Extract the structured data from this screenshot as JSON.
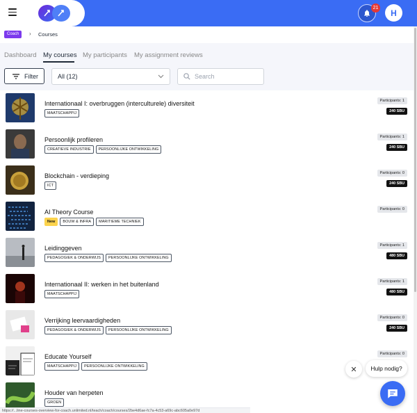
{
  "header": {
    "notification_count": "21",
    "user_initial": "H"
  },
  "breadcrumb": {
    "role": "Coach",
    "current": "Courses"
  },
  "tabs": [
    {
      "label": "Dashboard",
      "active": false
    },
    {
      "label": "My courses",
      "active": true
    },
    {
      "label": "My participants",
      "active": false
    },
    {
      "label": "My assignment reviews",
      "active": false
    }
  ],
  "filters": {
    "filter_label": "Filter",
    "select_value": "All (12)",
    "search_placeholder": "Search"
  },
  "courses": [
    {
      "title": "Internationaal I: overbruggen (interculturele) diversiteit",
      "tags": [
        "MAATSCHAPPIJ"
      ],
      "new": false,
      "participants": "Participants: 1",
      "sbu": "240 SBU",
      "thumb_color": "#1f3a6b"
    },
    {
      "title": "Persoonlijk profileren",
      "tags": [
        "CREATIEVE INDUSTRIE",
        "PERSOONLIJKE ONTWIKKELING"
      ],
      "new": false,
      "participants": "Participants: 1",
      "sbu": "240 SBU",
      "thumb_color": "#3a3a3a"
    },
    {
      "title": "Blockchain - verdieping",
      "tags": [
        "ICT"
      ],
      "new": false,
      "participants": "Participants: 0",
      "sbu": "240 SBU",
      "thumb_color": "#5a4a2a"
    },
    {
      "title": "AI Theory Course",
      "tags": [
        "BOUW & INFRA",
        "MARITIEME TECHNIEK"
      ],
      "new": true,
      "new_label": "New",
      "participants": "Participants: 0",
      "sbu": "",
      "thumb_color": "#12233f"
    },
    {
      "title": "Leidinggeven",
      "tags": [
        "PEDAGOGIEK & ONDERWIJS",
        "PERSOONLIJKE ONTWIKKELING"
      ],
      "new": false,
      "participants": "Participants: 1",
      "sbu": "480 SBU",
      "thumb_color": "#9aa0a6"
    },
    {
      "title": "Internationaal II: werken in het buitenland",
      "tags": [
        "MAATSCHAPPIJ"
      ],
      "new": false,
      "participants": "Participants: 1",
      "sbu": "480 SBU",
      "thumb_color": "#2a0a0a"
    },
    {
      "title": "Verrijking leervaardigheden",
      "tags": [
        "PEDAGOGIEK & ONDERWIJS",
        "PERSOONLIJKE ONTWIKKELING"
      ],
      "new": false,
      "participants": "Participants: 0",
      "sbu": "240 SBU",
      "thumb_color": "#dcdcdc"
    },
    {
      "title": "Educate Yourself",
      "tags": [
        "MAATSCHAPPIJ",
        "PERSOONLIJKE ONTWIKKELING"
      ],
      "new": false,
      "participants": "Participants: 0",
      "sbu": "",
      "thumb_color": "#7a6a5a"
    },
    {
      "title": "Houder van herpeten",
      "tags": [
        "GROEN"
      ],
      "new": false,
      "participants": "",
      "sbu": "",
      "thumb_color": "#3f7a3a"
    }
  ],
  "help": {
    "label": "Hulp nodig?"
  },
  "status_url": "https://...line-courses-overview-for-coach.unlimited.nl/teach/coach/courses/2be4d6ae-fc7a-4c53-a69c-abc605a0e97d",
  "colors": {
    "brand": "#3a6cf4",
    "badge_red": "#e53935",
    "role_purple": "#7c3aed",
    "new_yellow": "#fcd34d"
  }
}
